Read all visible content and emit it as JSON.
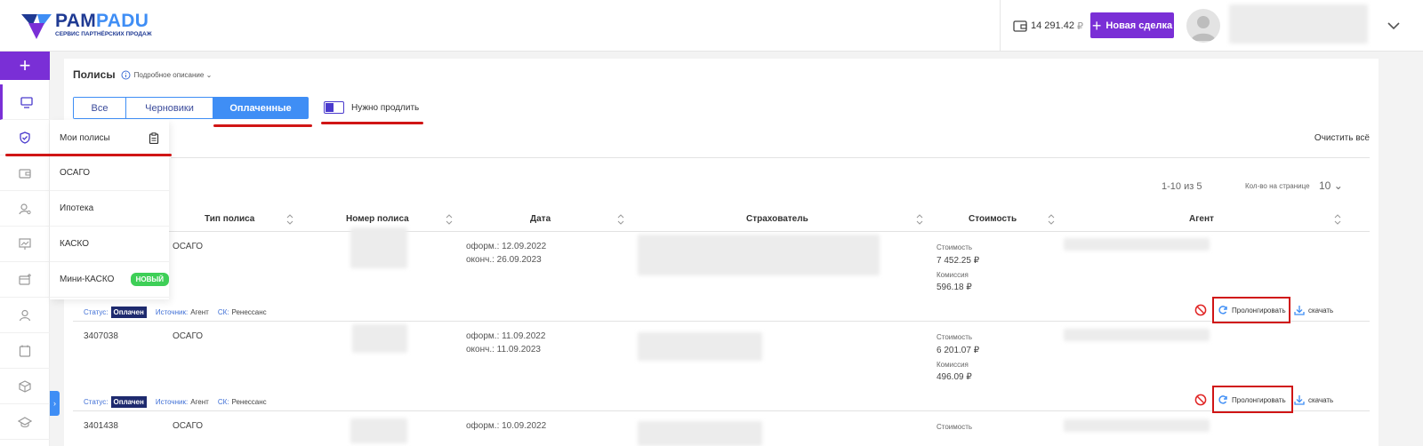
{
  "brand": {
    "name_part1": "PAM",
    "name_part2": "PADU",
    "tagline": "СЕРВИС ПАРТНЁРСКИХ ПРОДАЖ",
    "colors": {
      "accent": "#7a2fd6",
      "primary": "#3f8ef5",
      "dark": "#1f3a93"
    }
  },
  "header": {
    "balance": "14 291.42",
    "currency": "₽",
    "new_deal_label": "Новая сделка"
  },
  "nav": {
    "add_label": "+",
    "icons": [
      "monitor-icon",
      "shield-check-icon",
      "wallet-icon",
      "user-search-icon",
      "presentation-icon",
      "card-plus-icon",
      "user-icon",
      "calendar-icon",
      "box-icon",
      "graduation-cap-icon"
    ]
  },
  "flyout": {
    "items": [
      {
        "label": "Мои полисы"
      },
      {
        "label": "ОСАГО"
      },
      {
        "label": "Ипотека"
      },
      {
        "label": "КАСКО"
      },
      {
        "label": "Мини-КАСКО",
        "badge": "НОВЫЙ"
      }
    ]
  },
  "page": {
    "title": "Полисы",
    "description_link": "Подробное описание",
    "tabs": [
      {
        "label": "Все",
        "active": false
      },
      {
        "label": "Черновики",
        "active": false
      },
      {
        "label": "Оплаченные",
        "active": true
      }
    ],
    "toggle_label": "Нужно продлить",
    "clear_all": "Очистить всё",
    "pagination": "1-10 из 5",
    "per_page_label": "Кол-во на странице",
    "per_page_value": "10"
  },
  "table": {
    "headers": [
      "Тип полиса",
      "Номер полиса",
      "Дата",
      "Страхователь",
      "Стоимость",
      "Агент"
    ],
    "rows": [
      {
        "id": "",
        "type": "ОСАГО",
        "issued": "оформ.: 12.09.2022",
        "ends": "оконч.: 26.09.2023",
        "cost_label": "Стоимость",
        "cost": "7 452.25 ₽",
        "commission_label": "Комиссия",
        "commission": "596.18 ₽",
        "status_label": "Статус:",
        "status": "Оплачен",
        "source_label": "Источник:",
        "source": "Агент",
        "insurer_label": "СК:",
        "insurer": "Ренессанс",
        "prolong_label": "Пролонгировать",
        "download_label": "скачать"
      },
      {
        "id": "3407038",
        "type": "ОСАГО",
        "issued": "оформ.: 11.09.2022",
        "ends": "оконч.: 11.09.2023",
        "cost_label": "Стоимость",
        "cost": "6 201.07 ₽",
        "commission_label": "Комиссия",
        "commission": "496.09 ₽",
        "status_label": "Статус:",
        "status": "Оплачен",
        "source_label": "Источник:",
        "source": "Агент",
        "insurer_label": "СК:",
        "insurer": "Ренессанс",
        "prolong_label": "Пролонгировать",
        "download_label": "скачать"
      },
      {
        "id": "3401438",
        "type": "ОСАГО",
        "issued": "оформ.: 10.09.2022",
        "cost_label": "Стоимость"
      }
    ]
  }
}
